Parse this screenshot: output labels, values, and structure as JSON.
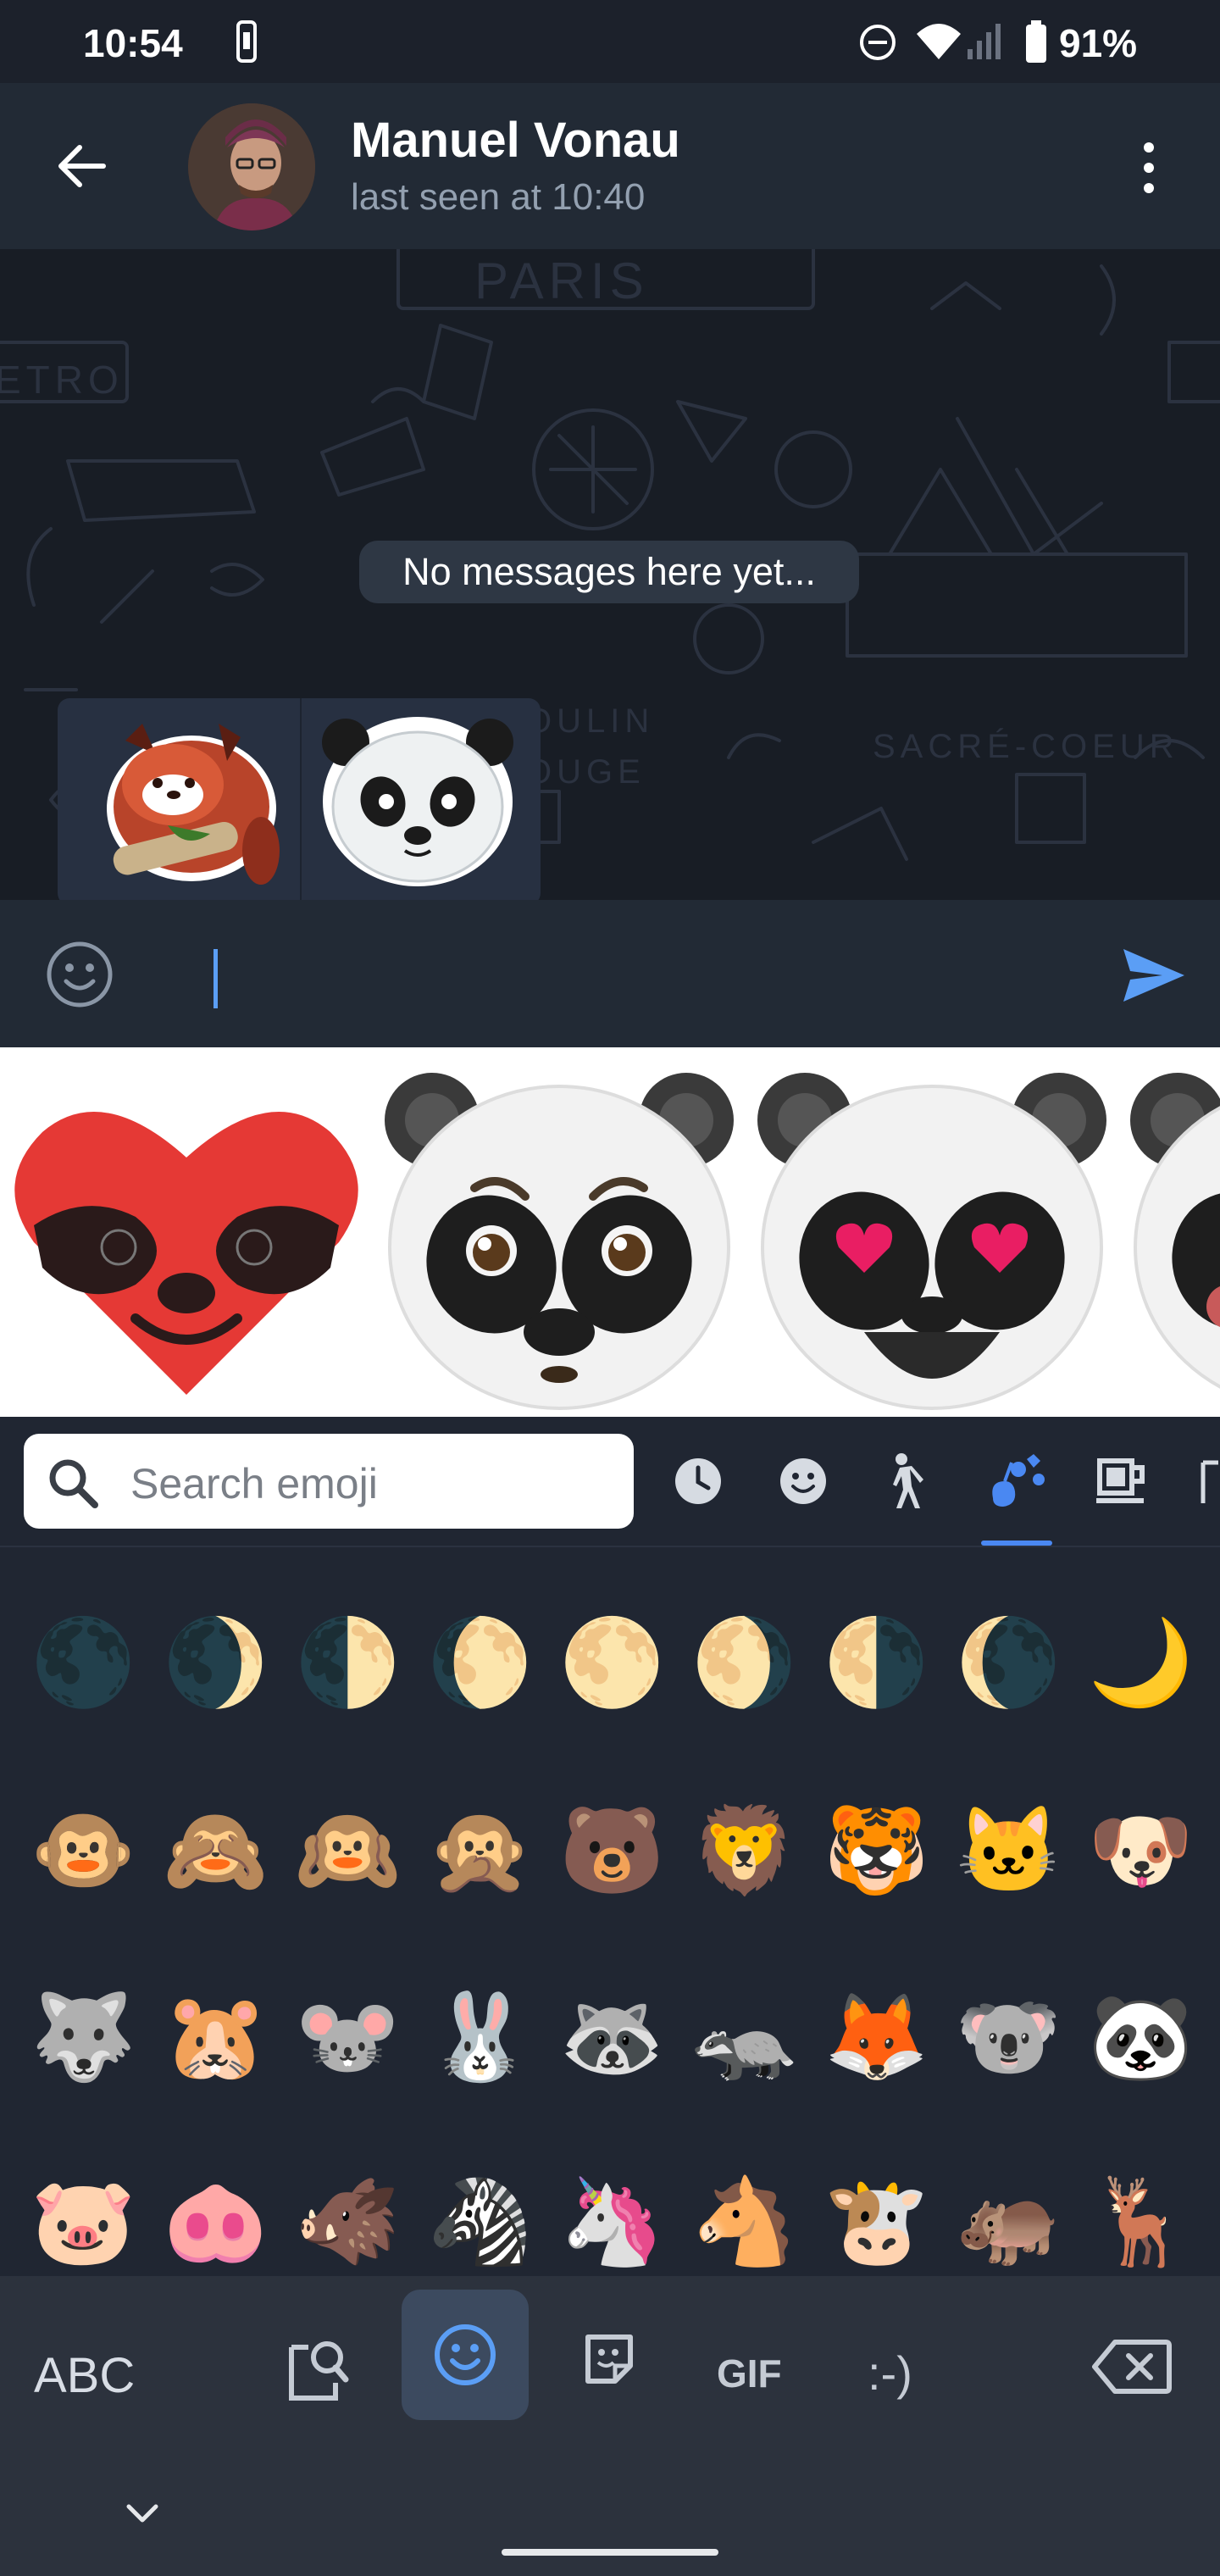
{
  "status_bar": {
    "time": "10:54",
    "battery": "91%"
  },
  "header": {
    "contact_name": "Manuel Vonau",
    "last_seen": "last seen at 10:40"
  },
  "chat": {
    "empty_text": "No messages here yet..."
  },
  "input": {
    "value": ""
  },
  "emoji_keyboard": {
    "search_placeholder": "Search emoji",
    "categories": [
      "recent-icon",
      "smileys-icon",
      "people-icon",
      "animals-nature-icon",
      "food-drink-icon",
      "objects-icon"
    ],
    "selected_category": "animals-nature-icon",
    "rows": [
      [
        "🌑",
        "🌒",
        "🌓",
        "🌔",
        "🌕",
        "🌖",
        "🌗",
        "🌘",
        "🌙"
      ],
      [
        "🐵",
        "🙈",
        "🙉",
        "🙊",
        "🐻",
        "🦁",
        "🐯",
        "🐱",
        "🐶"
      ],
      [
        "🐺",
        "🐹",
        "🐭",
        "🐰",
        "🦝",
        "🦡",
        "🦊",
        "🐨",
        "🐼"
      ],
      [
        "🐷",
        "🐽",
        "🐗",
        "🦓",
        "🦄",
        "🐴",
        "🐮",
        "🦛",
        "🦌"
      ]
    ]
  },
  "bottom_bar": {
    "abc_label": "ABC",
    "gif_label": "GIF",
    "emoticon_label": ":-)"
  },
  "colors": {
    "accent": "#5b9ef5",
    "header_bg": "#222a35",
    "keyboard_bg": "#202632"
  }
}
